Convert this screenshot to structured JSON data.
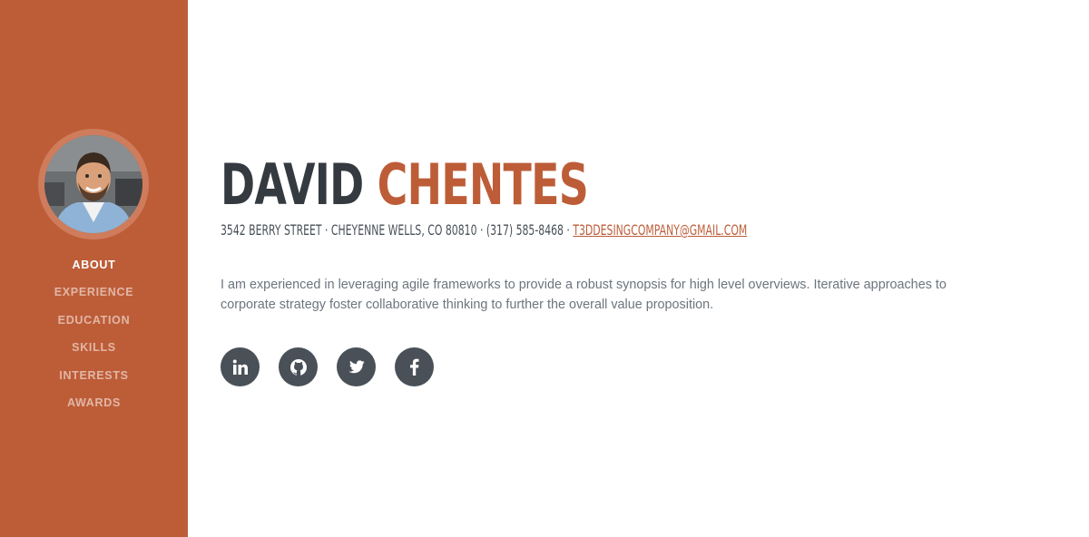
{
  "profile": {
    "first_name": "DAVID",
    "last_name": "CHENTES",
    "address_line": "3542 Berry Street · Cheyenne Wells, CO 80810 · (317) 585-8468 · ",
    "email": "T3DDESINGCOMPANY@GMAIL.COM",
    "bio": "I am experienced in leveraging agile frameworks to provide a robust synopsis for high level overviews. Iterative approaches to corporate strategy foster collaborative thinking to further the overall value proposition."
  },
  "nav": {
    "items": [
      {
        "label": "ABOUT",
        "active": true
      },
      {
        "label": "EXPERIENCE",
        "active": false
      },
      {
        "label": "EDUCATION",
        "active": false
      },
      {
        "label": "SKILLS",
        "active": false
      },
      {
        "label": "INTERESTS",
        "active": false
      },
      {
        "label": "AWARDS",
        "active": false
      }
    ]
  },
  "social": {
    "icons": [
      "linkedin-icon",
      "github-icon",
      "twitter-icon",
      "facebook-icon"
    ]
  },
  "colors": {
    "accent": "#bd5d38",
    "dark": "#343a40",
    "social_bg": "#495057"
  }
}
